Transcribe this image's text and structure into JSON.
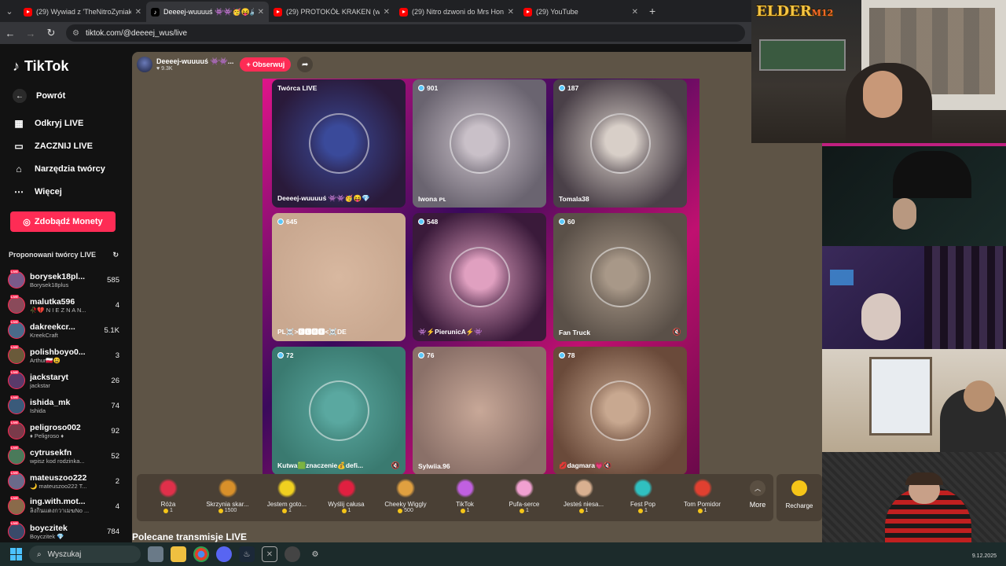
{
  "browser": {
    "tabs": [
      {
        "title": "(29) Wywiad z 'TheNitroZyniak'",
        "icon": "youtube-icon",
        "active": false
      },
      {
        "title": "Deeeej-wuuuuś 👾👾🥳😝🔊",
        "icon": "tiktok-icon",
        "active": true
      },
      {
        "title": "(29) PROTOKÓŁ KRAKEN (wpro",
        "icon": "youtube-icon",
        "active": false
      },
      {
        "title": "(29) Nitro dzwoni do Mrs Hone",
        "icon": "youtube-icon",
        "active": false
      },
      {
        "title": "(29) YouTube",
        "icon": "youtube-icon",
        "active": false
      }
    ],
    "url": "tiktok.com/@deeeej_wus/live"
  },
  "sidebar": {
    "logo": "TikTok",
    "back": "Powrót",
    "nav": [
      {
        "label": "Odkryj LIVE",
        "icon": "calendar-icon"
      },
      {
        "label": "ZACZNIJ LIVE",
        "icon": "camera-icon"
      },
      {
        "label": "Narzędzia twórcy",
        "icon": "home-icon"
      },
      {
        "label": "Więcej",
        "icon": "more-icon"
      }
    ],
    "coins_button": "Zdobądź Monety",
    "suggested_title": "Proponowani twórcy LIVE",
    "creators": [
      {
        "name": "borysek18pl...",
        "sub": "Borysek18plus",
        "count": "585",
        "color": "#7a5a8a"
      },
      {
        "name": "malutka596",
        "sub": "🥀💔 N I E Z N A N...",
        "count": "4",
        "color": "#8a4a5a"
      },
      {
        "name": "dakreekcr...",
        "sub": "KreekCraft",
        "count": "5.1K",
        "color": "#4a6a8a"
      },
      {
        "name": "polishboyo0...",
        "sub": "Arthur🇵🇱😫",
        "count": "3",
        "color": "#6a5a3a"
      },
      {
        "name": "jackstaryt",
        "sub": "jackstar",
        "count": "26",
        "color": "#5a3a6a"
      },
      {
        "name": "ishida_mk",
        "sub": "Ishida",
        "count": "74",
        "color": "#3a5a7a"
      },
      {
        "name": "peligroso002",
        "sub": "♦ Peligroso ♦",
        "count": "92",
        "color": "#7a3a4a"
      },
      {
        "name": "cytrusekfn",
        "sub": "wpisz kod rodzinka...",
        "count": "52",
        "color": "#4a7a5a"
      },
      {
        "name": "mateuszoo222",
        "sub": "🌙 mateuszoo222 T...",
        "count": "2",
        "color": "#6a6a8a"
      },
      {
        "name": "ing.with.mot...",
        "sub": "ลิงกินแตงกวาเมฆNo ...",
        "count": "4",
        "color": "#8a6a4a"
      },
      {
        "name": "boyczitek",
        "sub": "Boyczitek 💎",
        "count": "784",
        "color": "#3a4a6a"
      }
    ]
  },
  "stage": {
    "host_name": "Deeeej-wuuuuś 👾👾...",
    "host_likes": "♥ 9.3K",
    "follow": "+ Obserwuj",
    "tiles": [
      {
        "badge": "Twórca LIVE",
        "name": "Deeeej-wuuuuś 👾👾🥳😝💎",
        "bg": "#2a1a3a",
        "face": "#3a4a9a",
        "circle": true,
        "mute": false
      },
      {
        "badge": "901",
        "name": "Iwona ᴘʟ",
        "bg": "#6a6470",
        "face": "#c9c0c8",
        "circle": true,
        "mute": false
      },
      {
        "badge": "187",
        "name": "Tomala38",
        "bg": "#4a4048",
        "face": "#d8cfc8",
        "circle": true,
        "mute": false
      },
      {
        "badge": "645",
        "name": "PL☠️>🅴🅻🅱🅴<☠️DE",
        "bg": "#c9a890",
        "face": "#d8b8a0",
        "circle": false,
        "mute": false
      },
      {
        "badge": "548",
        "name": "👾⚡PierunicA⚡👾",
        "bg": "#3a1a3a",
        "face": "#e0a0c0",
        "circle": true,
        "mute": false
      },
      {
        "badge": "60",
        "name": "Fan Truck",
        "bg": "#5a5048",
        "face": "#a89888",
        "circle": true,
        "mute": true
      },
      {
        "badge": "72",
        "name": "Kutwa🟩znaczenie💰defi...",
        "bg": "#3a7a70",
        "face": "#5aa8a0",
        "circle": true,
        "mute": true
      },
      {
        "badge": "76",
        "name": "Sylwiia.96",
        "bg": "#8a7068",
        "face": "#c8a898",
        "circle": false,
        "mute": false
      },
      {
        "badge": "78",
        "name": "💋dagmara💗🔇",
        "bg": "#6a4a3a",
        "face": "#c8a890",
        "circle": true,
        "mute": false
      }
    ],
    "gifts": [
      {
        "name": "Róża",
        "price": "1",
        "color": "#e0304a"
      },
      {
        "name": "Skrzynia skar...",
        "price": "1500",
        "color": "#d8902a"
      },
      {
        "name": "Jestem goto...",
        "price": "1",
        "color": "#f0d020"
      },
      {
        "name": "Wyślij całusa",
        "price": "1",
        "color": "#e02040"
      },
      {
        "name": "Cheeky Wiggly",
        "price": "500",
        "color": "#e0a040"
      },
      {
        "name": "TikTok",
        "price": "1",
        "color": "#c060e0"
      },
      {
        "name": "Pufa-serce",
        "price": "1",
        "color": "#f0a0d0"
      },
      {
        "name": "Jesteś niesa...",
        "price": "1",
        "color": "#d8b090"
      },
      {
        "name": "Fest Pop",
        "price": "1",
        "color": "#30c0c0"
      },
      {
        "name": "Tom Pomidor",
        "price": "1",
        "color": "#e04030"
      }
    ],
    "more": "More",
    "recharge": "Recharge",
    "recommended": "Polecane transmisje LIVE"
  },
  "overlay": {
    "logo_main": "ELDER",
    "logo_sub": "M12"
  },
  "taskbar": {
    "search": "Wyszukaj",
    "date": "9.12.2025"
  }
}
